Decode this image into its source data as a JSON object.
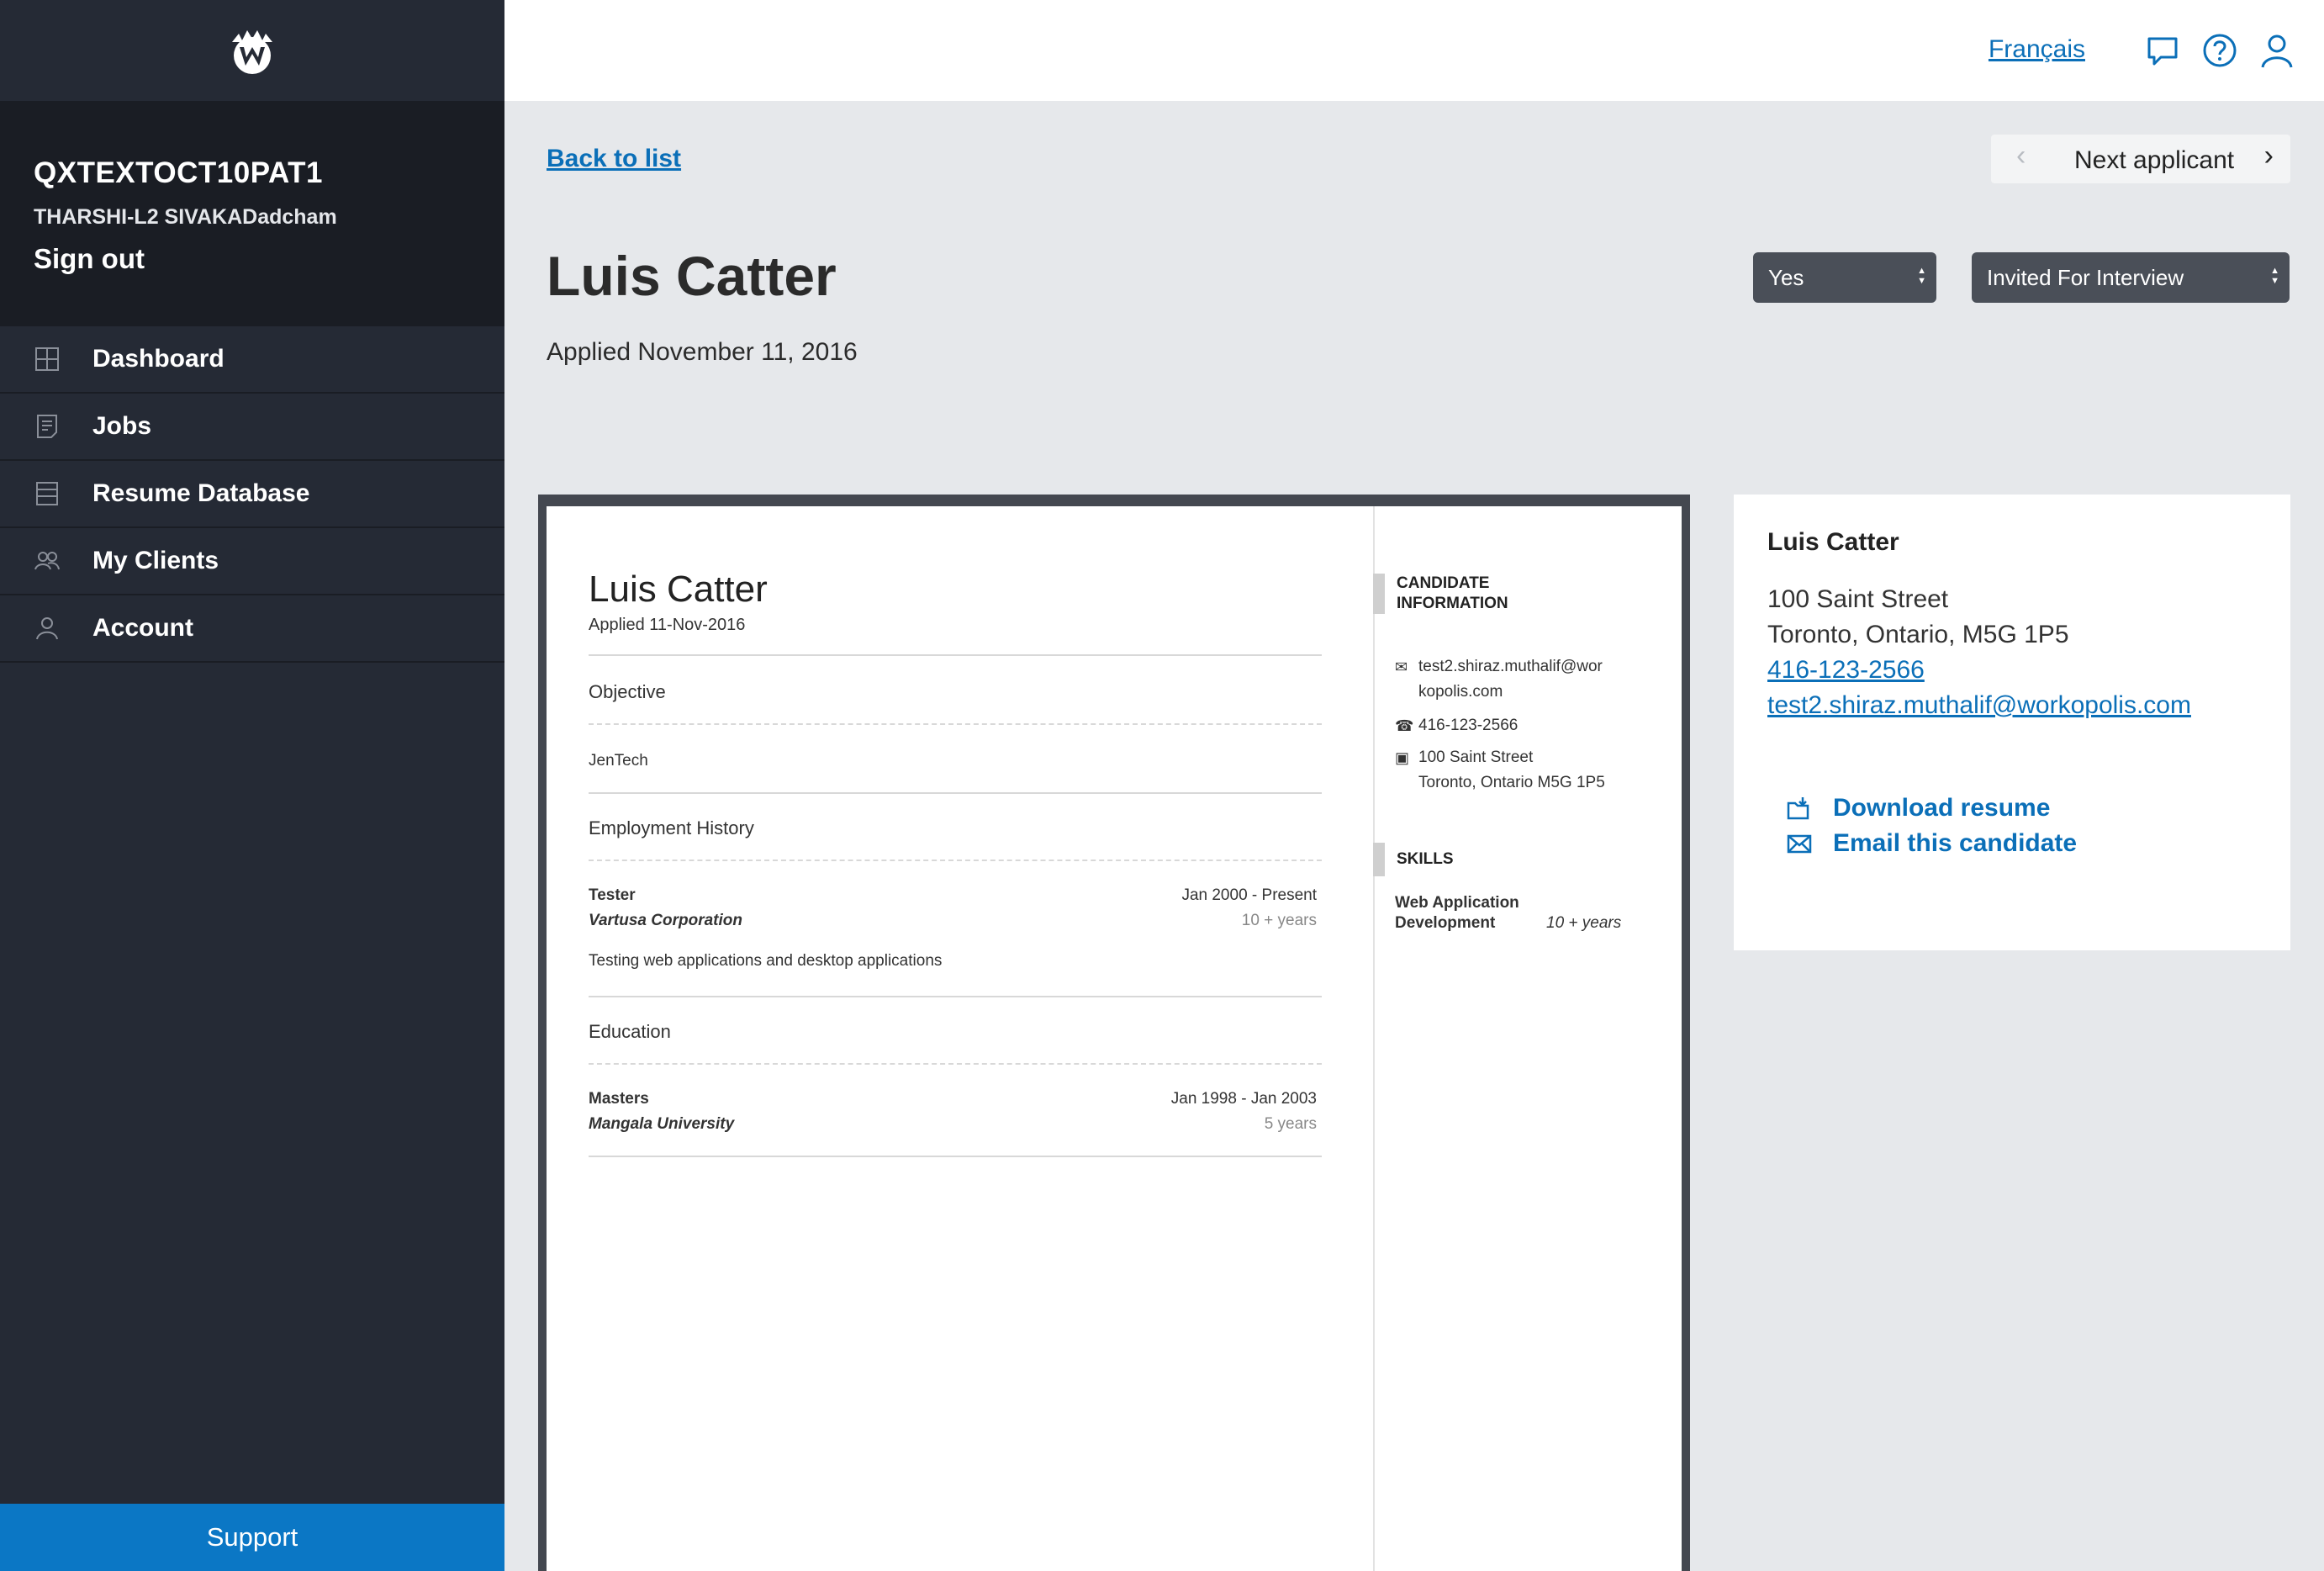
{
  "sidebar": {
    "logo": "w-crown-logo",
    "account_code": "QXTEXTOCT10PAT1",
    "user_name": "THARSHI-L2 SIVAKADadcham",
    "sign_out": "Sign out",
    "nav": [
      {
        "label": "Dashboard",
        "icon": "grid-icon"
      },
      {
        "label": "Jobs",
        "icon": "document-icon"
      },
      {
        "label": "Resume Database",
        "icon": "database-icon"
      },
      {
        "label": "My Clients",
        "icon": "users-icon"
      },
      {
        "label": "Account",
        "icon": "user-icon"
      }
    ],
    "support": "Support"
  },
  "topbar": {
    "language": "Français",
    "icons": [
      "chat-icon",
      "help-icon",
      "profile-icon"
    ]
  },
  "header": {
    "back_link": "Back to list",
    "next_applicant": "Next applicant",
    "name": "Luis Catter",
    "applied": "Applied November 11, 2016",
    "select_yes": "Yes",
    "select_status": "Invited For Interview"
  },
  "resume": {
    "name": "Luis Catter",
    "applied": "Applied 11-Nov-2016",
    "objective_title": "Objective",
    "objective_text": "JenTech",
    "employment_title": "Employment History",
    "job_title": "Tester",
    "job_company": "Vartusa Corporation",
    "job_dates": "Jan 2000 - Present",
    "job_duration": "10 + years",
    "job_desc": "Testing web applications and desktop applications",
    "education_title": "Education",
    "edu_degree": "Masters",
    "edu_school": "Mangala University",
    "edu_dates": "Jan 1998 - Jan 2003",
    "edu_duration": "5 years",
    "candidate_info_title_1": "CANDIDATE",
    "candidate_info_title_2": "INFORMATION",
    "email_line_1": "test2.shiraz.muthalif@wor",
    "email_line_2": "kopolis.com",
    "phone": "416-123-2566",
    "address_line_1": "100 Saint Street",
    "address_line_2": "Toronto, Ontario M5G 1P5",
    "skills_title": "SKILLS",
    "skill_name_1": "Web Application",
    "skill_name_2": "Development",
    "skill_years": "10 + years"
  },
  "contact": {
    "name": "Luis Catter",
    "address_1": "100 Saint Street",
    "address_2": "Toronto, Ontario, M5G 1P5",
    "phone": "416-123-2566",
    "email": "test2.shiraz.muthalif@workopolis.com",
    "download": "Download resume",
    "email_candidate": "Email this candidate"
  },
  "colors": {
    "sidebar": "#252a35",
    "sidebar_dark": "#1a1d24",
    "accent": "#0b77c5",
    "link": "#0b6fb8"
  }
}
